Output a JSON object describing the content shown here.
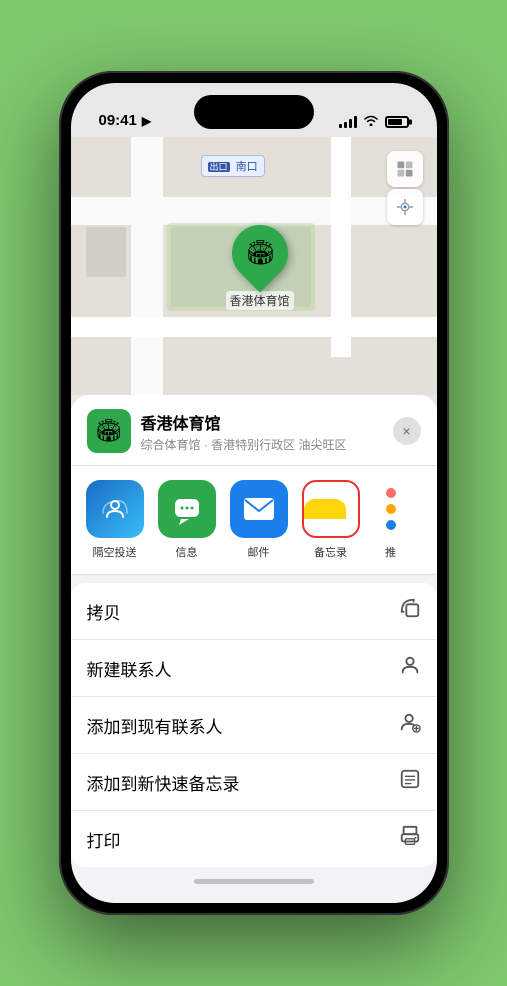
{
  "status_bar": {
    "time": "09:41",
    "location_arrow": "▸"
  },
  "map": {
    "label": "南口",
    "pin_name": "香港体育馆",
    "pin_emoji": "🏟"
  },
  "location_card": {
    "name": "香港体育馆",
    "subtitle": "综合体育馆 · 香港特别行政区 油尖旺区",
    "icon_emoji": "🏟",
    "close_label": "×"
  },
  "share_items": [
    {
      "id": "airdrop",
      "label": "隔空投送",
      "emoji": "📡"
    },
    {
      "id": "messages",
      "label": "信息",
      "emoji": "💬"
    },
    {
      "id": "mail",
      "label": "邮件",
      "emoji": "✉️"
    },
    {
      "id": "notes",
      "label": "备忘录",
      "emoji": ""
    },
    {
      "id": "more",
      "label": "推",
      "emoji": "•••"
    }
  ],
  "action_items": [
    {
      "label": "拷贝",
      "icon": "⧉"
    },
    {
      "label": "新建联系人",
      "icon": "👤"
    },
    {
      "label": "添加到现有联系人",
      "icon": "👤+"
    },
    {
      "label": "添加到新快速备忘录",
      "icon": "▦"
    },
    {
      "label": "打印",
      "icon": "🖨"
    }
  ]
}
